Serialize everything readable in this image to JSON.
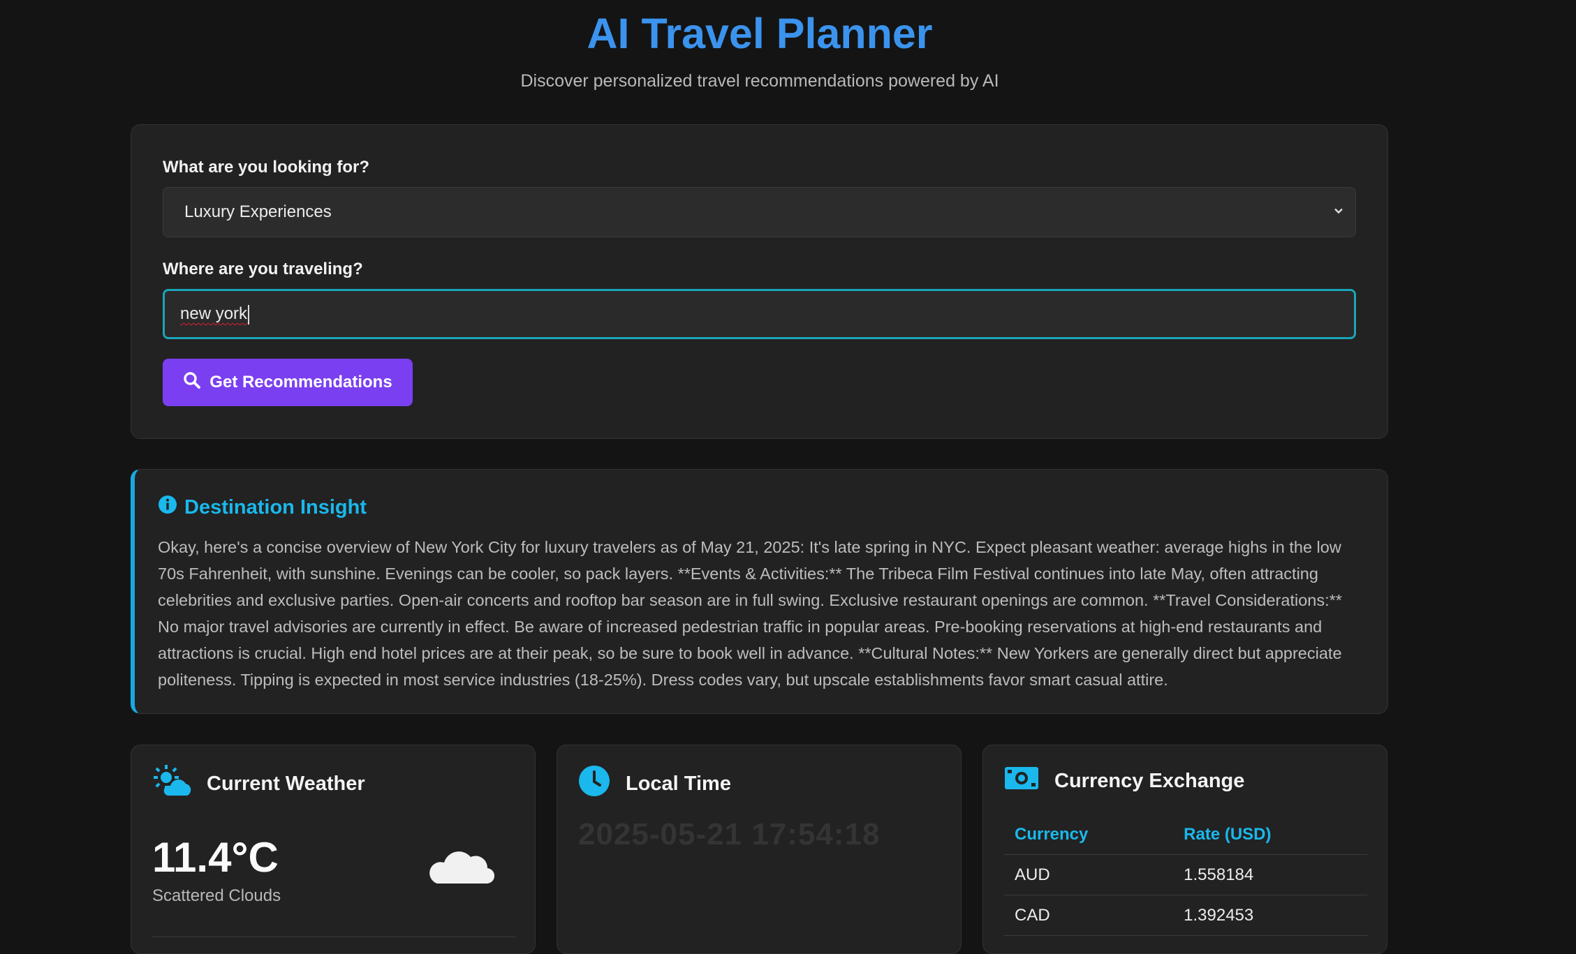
{
  "header": {
    "title": "AI Travel Planner",
    "subtitle": "Discover personalized travel recommendations powered by AI"
  },
  "form": {
    "category_label": "What are you looking for?",
    "category_value": "Luxury Experiences",
    "destination_label": "Where are you traveling?",
    "destination_value": "new york",
    "submit_label": "Get Recommendations"
  },
  "insight": {
    "title": "Destination Insight",
    "text": "Okay, here's a concise overview of New York City for luxury travelers as of May 21, 2025: It's late spring in NYC. Expect pleasant weather: average highs in the low 70s Fahrenheit, with sunshine. Evenings can be cooler, so pack layers. **Events & Activities:** The Tribeca Film Festival continues into late May, often attracting celebrities and exclusive parties. Open-air concerts and rooftop bar season are in full swing. Exclusive restaurant openings are common. **Travel Considerations:** No major travel advisories are currently in effect. Be aware of increased pedestrian traffic in popular areas. Pre-booking reservations at high-end restaurants and attractions is crucial. High end hotel prices are at their peak, so be sure to book well in advance. **Cultural Notes:** New Yorkers are generally direct but appreciate politeness. Tipping is expected in most service industries (18-25%). Dress codes vary, but upscale establishments favor smart casual attire."
  },
  "weather": {
    "title": "Current Weather",
    "temperature": "11.4°C",
    "condition": "Scattered Clouds",
    "icon": "cloud-icon"
  },
  "local_time": {
    "title": "Local Time",
    "value": "2025-05-21 17:54:18",
    "icon": "clock-icon"
  },
  "currency": {
    "title": "Currency Exchange",
    "icon": "money-bill-icon",
    "columns": [
      "Currency",
      "Rate (USD)"
    ],
    "rows": [
      {
        "code": "AUD",
        "rate": "1.558184"
      },
      {
        "code": "CAD",
        "rate": "1.392453"
      }
    ]
  },
  "colors": {
    "title": "#3b93ee",
    "accent_cyan": "#1ab8ec",
    "button": "#7a3ff0",
    "background": "#141414",
    "card": "#222222"
  }
}
